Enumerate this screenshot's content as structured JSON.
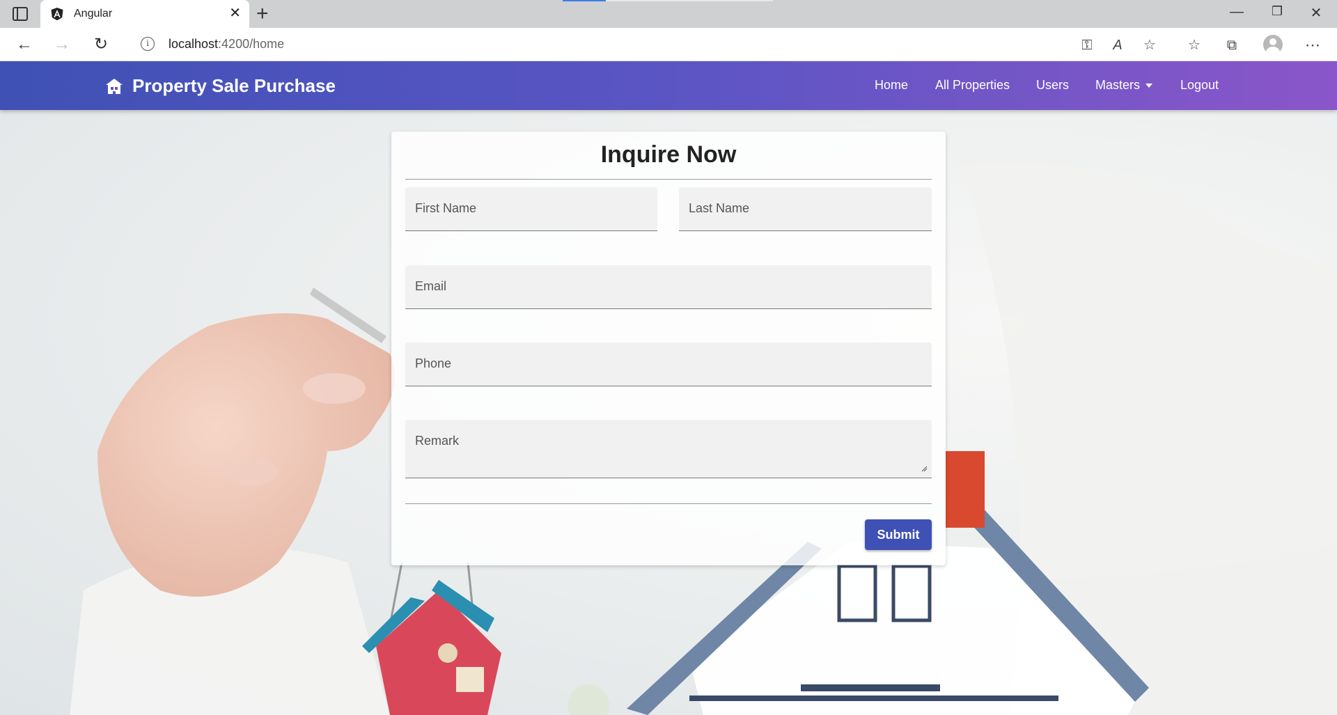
{
  "browser": {
    "tab_title": "Angular",
    "tab_close": "✕",
    "new_tab": "+",
    "window_controls": [
      "—",
      "❐",
      "✕"
    ],
    "back": "←",
    "forward": "→",
    "reload": "↻",
    "url_host": "localhost",
    "url_rest": ":4200/home",
    "info_icon": "i",
    "tool_icons": [
      "key-icon",
      "read-aloud-icon",
      "add-favorite-icon",
      "favorites-icon",
      "collections-icon",
      "profile-icon",
      "more-icon"
    ],
    "tool_glyphs": [
      "⚿",
      "A",
      "☆",
      "☆",
      "⧉",
      "",
      "⋯"
    ]
  },
  "navbar": {
    "brand": "Property Sale Purchase",
    "links": {
      "home": "Home",
      "all_properties": "All Properties",
      "users": "Users",
      "masters": "Masters",
      "logout": "Logout"
    },
    "gradient": [
      "#3f51b5",
      "#8a56c9"
    ]
  },
  "form": {
    "title": "Inquire Now",
    "first_name": "First Name",
    "last_name": "Last Name",
    "email": "Email",
    "phone": "Phone",
    "remark": "Remark",
    "submit": "Submit"
  },
  "colors": {
    "accent": "#3f51b5"
  }
}
